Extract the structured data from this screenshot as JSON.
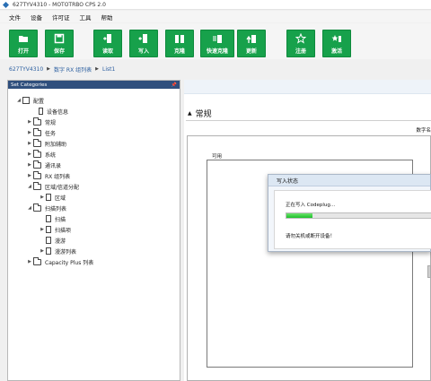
{
  "window": {
    "title": "627TYV4310 - MOTOTRBO CPS 2.0"
  },
  "menu": [
    "文件",
    "设备",
    "许可证",
    "工具",
    "帮助"
  ],
  "toolbar": {
    "open": "打开",
    "save": "保存",
    "read": "读取",
    "write": "写入",
    "clone": "克隆",
    "quick_clone": "快速克隆",
    "update": "更新",
    "register": "注册",
    "activate": "激活"
  },
  "breadcrumb": [
    "627TYV4310",
    "数字 RX 组列表",
    "List1"
  ],
  "left_panel": {
    "header": "Set Categories",
    "pin_glyph": "📌",
    "tree": [
      {
        "label": "配置"
      },
      {
        "label": "设备信息"
      },
      {
        "label": "常规"
      },
      {
        "label": "任务"
      },
      {
        "label": "附加辅助"
      },
      {
        "label": "系统"
      },
      {
        "label": "通讯录"
      },
      {
        "label": "RX 组列表"
      },
      {
        "label": "区域/信道分配"
      },
      {
        "label": "区域"
      },
      {
        "label": "扫描列表"
      },
      {
        "label": "扫描"
      },
      {
        "label": "扫描项"
      },
      {
        "label": "漫游"
      },
      {
        "label": "漫游列表"
      },
      {
        "label": "Capacity Plus 列表"
      }
    ]
  },
  "right_panel": {
    "section_title": "常规",
    "column_header": "数字名",
    "available_label": "可用"
  },
  "dialog": {
    "title": "写入状态",
    "message": "正在写入 Codeplug...",
    "progress": 0.18,
    "hint": "请勿关机或断开设备！"
  },
  "colors": {
    "accent_green": "#17a14b",
    "header_blue": "#2f4f7d",
    "progress_green": "#1cbf2a"
  }
}
